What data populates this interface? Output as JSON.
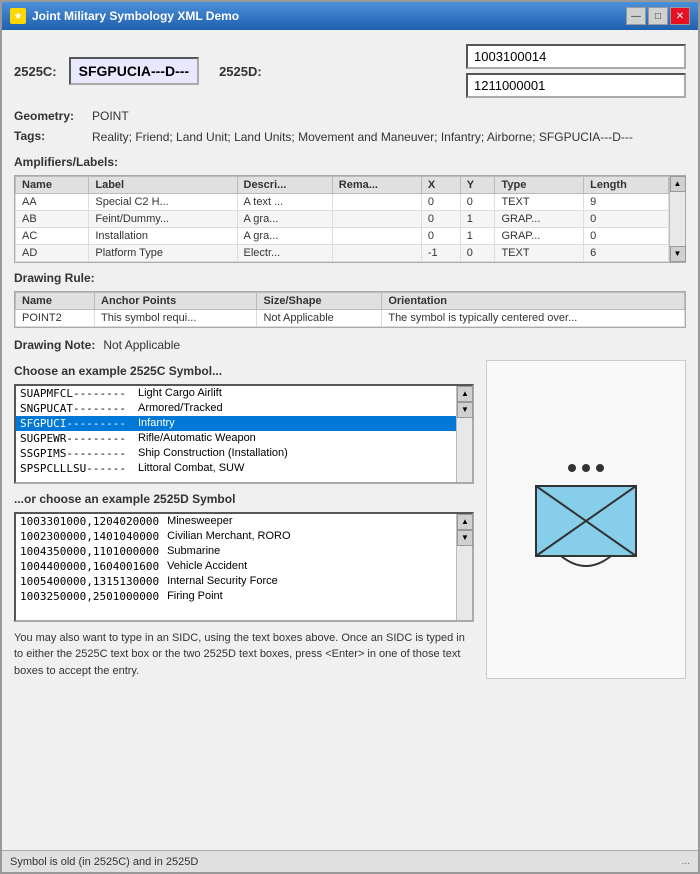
{
  "window": {
    "title": "Joint Military Symbology XML Demo",
    "icon": "★"
  },
  "titleButtons": {
    "minimize": "—",
    "maximize": "□",
    "close": "✕"
  },
  "sidc2525c": {
    "label": "2525C:",
    "value": "SFGPUCIA---D---"
  },
  "sidc2525d": {
    "label": "2525D:",
    "input1": "1003100014",
    "input2": "1211000001"
  },
  "geometry": {
    "label": "Geometry:",
    "value": "POINT"
  },
  "tags": {
    "label": "Tags:",
    "value": "Reality; Friend; Land Unit; Land Units; Movement and Maneuver; Infantry; Airborne; SFGPUCIA---D---"
  },
  "amplifiers": {
    "sectionLabel": "Amplifiers/Labels:",
    "columns": [
      "Name",
      "Label",
      "Descri...",
      "Rema...",
      "X",
      "Y",
      "Type",
      "Length"
    ],
    "rows": [
      {
        "name": "AA",
        "label": "Special C2 H...",
        "desc": "A text ...",
        "rema": "",
        "x": "0",
        "y": "0",
        "type": "TEXT",
        "length": "9"
      },
      {
        "name": "AB",
        "label": "Feint/Dummy...",
        "desc": "A gra...",
        "rema": "",
        "x": "0",
        "y": "1",
        "type": "GRAP...",
        "length": "0"
      },
      {
        "name": "AC",
        "label": "Installation",
        "desc": "A gra...",
        "rema": "",
        "x": "0",
        "y": "1",
        "type": "GRAP...",
        "length": "0"
      },
      {
        "name": "AD",
        "label": "Platform Type",
        "desc": "Electr...",
        "rema": "",
        "x": "-1",
        "y": "0",
        "type": "TEXT",
        "length": "6"
      }
    ]
  },
  "drawingRule": {
    "sectionLabel": "Drawing Rule:",
    "columns": [
      "Name",
      "Anchor Points",
      "Size/Shape",
      "Orientation"
    ],
    "rows": [
      {
        "name": "POINT2",
        "anchor": "This symbol requi...",
        "size": "Not Applicable",
        "orientation": "The symbol is typically centered over..."
      }
    ]
  },
  "drawingNote": {
    "label": "Drawing Note:",
    "value": "Not Applicable"
  },
  "symbolList": {
    "chooseLabel": "Choose an example 2525C Symbol...",
    "items": [
      {
        "code": "SUAPMFCL--------",
        "desc": "Light Cargo Airlift"
      },
      {
        "code": "SNGPUCAT--------",
        "desc": "Armored/Tracked"
      },
      {
        "code": "SFGPUCI---------",
        "desc": "Infantry",
        "selected": true
      },
      {
        "code": "SUGPEWR---------",
        "desc": "Rifle/Automatic Weapon"
      },
      {
        "code": "SSGPIMS---------",
        "desc": "Ship Construction (Installation)"
      },
      {
        "code": "SPSPCLLLSU------",
        "desc": "Littoral Combat, SUW"
      }
    ]
  },
  "symbolList2525d": {
    "chooseLabel": "...or choose an example 2525D Symbol",
    "items": [
      {
        "code": "1003301000,1204020000",
        "desc": "Minesweeper"
      },
      {
        "code": "1002300000,1401040000",
        "desc": "Civilian Merchant, RORO"
      },
      {
        "code": "1004350000,1101000000",
        "desc": "Submarine"
      },
      {
        "code": "1004400000,1604001600",
        "desc": "Vehicle Accident"
      },
      {
        "code": "1005400000,1315130000",
        "desc": "Internal Security Force"
      },
      {
        "code": "1003250000,2501000000",
        "desc": "Firing Point"
      }
    ]
  },
  "descNote": "You may also want to type in an SIDC, using the text boxes above.  Once an SIDC is typed in to either the 2525C text box or the two 2525D text boxes, press <Enter> in one of those text boxes to accept the entry.",
  "statusBar": {
    "text": "Symbol is old (in 2525C) and in 2525D",
    "right": "..."
  }
}
